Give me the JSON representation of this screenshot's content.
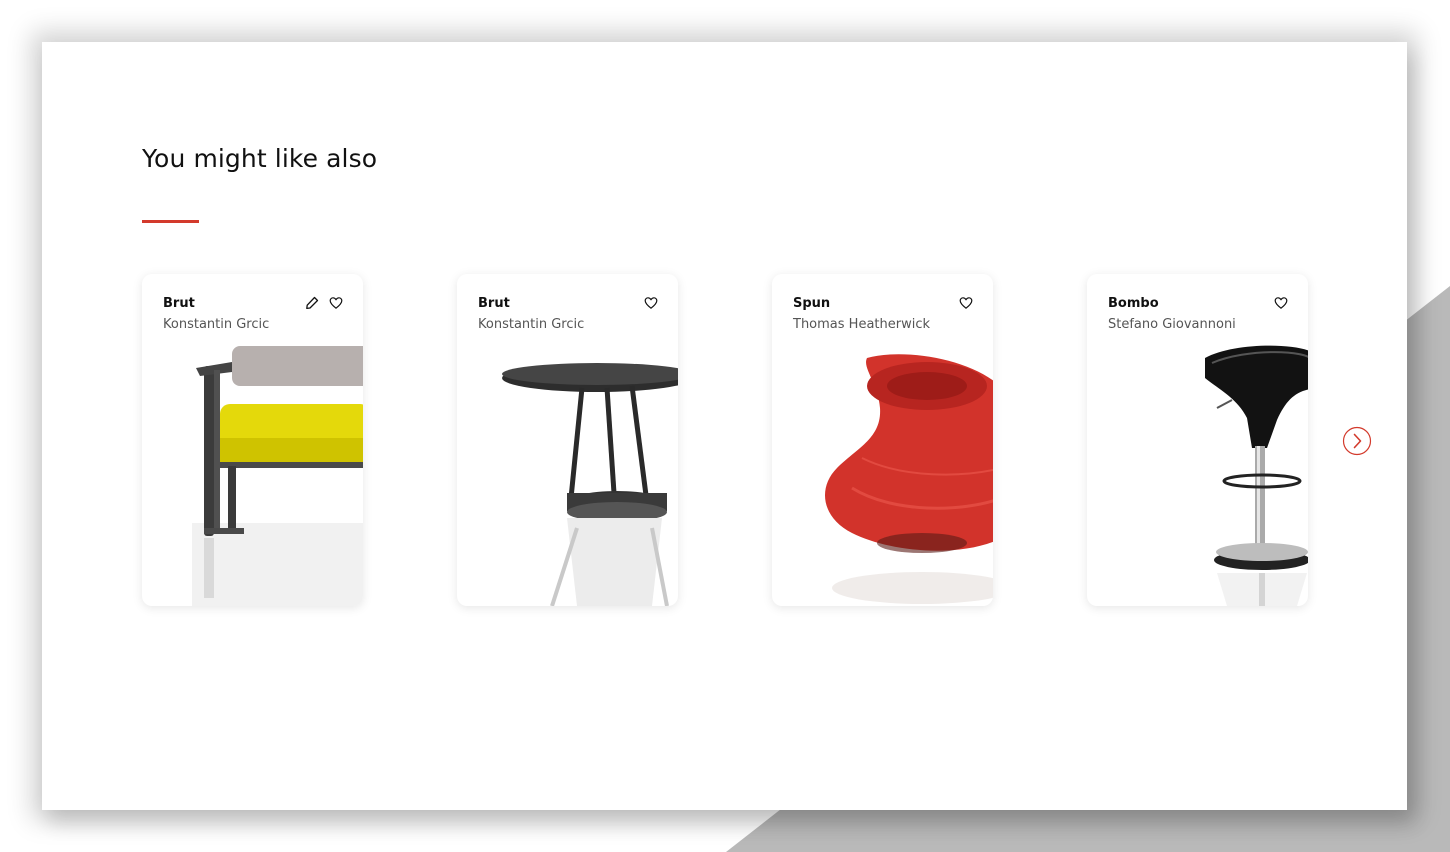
{
  "section": {
    "title": "You might like also",
    "accent_color": "#d33a2c"
  },
  "products": [
    {
      "name": "Brut",
      "designer": "Konstantin Grcic",
      "image": "lounge-chair-yellow",
      "actions": [
        "edit-icon",
        "heart-icon"
      ]
    },
    {
      "name": "Brut",
      "designer": "Konstantin Grcic",
      "image": "round-table-black",
      "actions": [
        "heart-icon"
      ]
    },
    {
      "name": "Spun",
      "designer": "Thomas Heatherwick",
      "image": "spun-chair-red",
      "actions": [
        "heart-icon"
      ]
    },
    {
      "name": "Bombo",
      "designer": "Stefano Giovannoni",
      "image": "bar-stool-black",
      "actions": [
        "heart-icon"
      ]
    }
  ],
  "carousel": {
    "next_icon": "chevron-right-icon"
  }
}
